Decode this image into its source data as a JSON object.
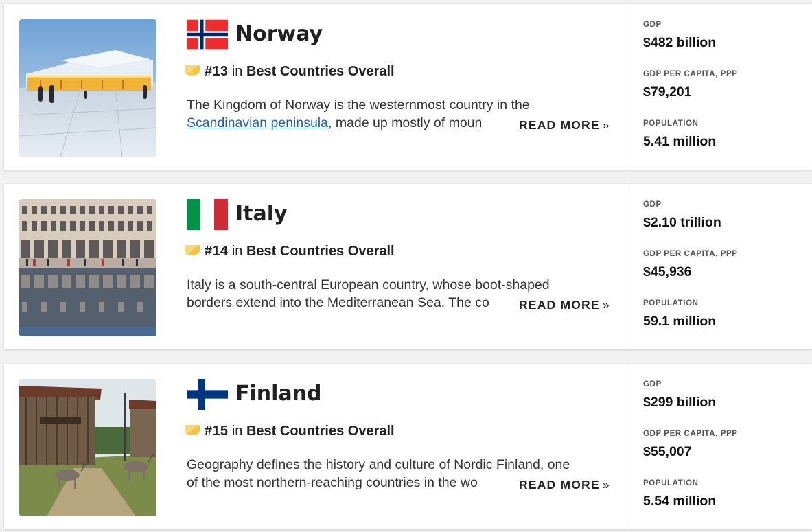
{
  "countries": [
    {
      "name": "Norway",
      "rank": "#13",
      "in": "in",
      "category": "Best Countries Overall",
      "desc_line1": "The Kingdom of Norway is the westernmost country in the",
      "desc_link": "Scandinavian peninsula",
      "desc_line2_rest": ", made up mostly of moun",
      "read_more": "READ MORE",
      "stats": {
        "gdp_label": "GDP",
        "gdp": "$482 billion",
        "gdppc_label": "GDP PER CAPITA, PPP",
        "gdppc": "$79,201",
        "pop_label": "POPULATION",
        "pop": "5.41 million"
      }
    },
    {
      "name": "Italy",
      "rank": "#14",
      "in": "in",
      "category": "Best Countries Overall",
      "desc_line1": "Italy is a south-central European country, whose boot-shaped",
      "desc_line2": "borders extend into the Mediterranean Sea. The co",
      "read_more": "READ MORE",
      "stats": {
        "gdp_label": "GDP",
        "gdp": "$2.10 trillion",
        "gdppc_label": "GDP PER CAPITA, PPP",
        "gdppc": "$45,936",
        "pop_label": "POPULATION",
        "pop": "59.1 million"
      }
    },
    {
      "name": "Finland",
      "rank": "#15",
      "in": "in",
      "category": "Best Countries Overall",
      "desc_line1": "Geography defines the history and culture of Nordic Finland, one",
      "desc_line2": "of the most northern-reaching countries in the wo",
      "read_more": "READ MORE",
      "stats": {
        "gdp_label": "GDP",
        "gdp": "$299 billion",
        "gdppc_label": "GDP PER CAPITA, PPP",
        "gdppc": "$55,007",
        "pop_label": "POPULATION",
        "pop": "5.54 million"
      }
    }
  ],
  "read_more_glyph": "»",
  "colors": {
    "link": "#1a5fb4",
    "badge": "#f3c541",
    "norway_red": "#ef2b2d",
    "norway_blue": "#002868",
    "italy_green": "#009246",
    "italy_red": "#ce2b37",
    "finland_blue": "#003580"
  },
  "icons": [
    "norway-flag-icon",
    "italy-flag-icon",
    "finland-flag-icon",
    "rank-badge-icon"
  ]
}
